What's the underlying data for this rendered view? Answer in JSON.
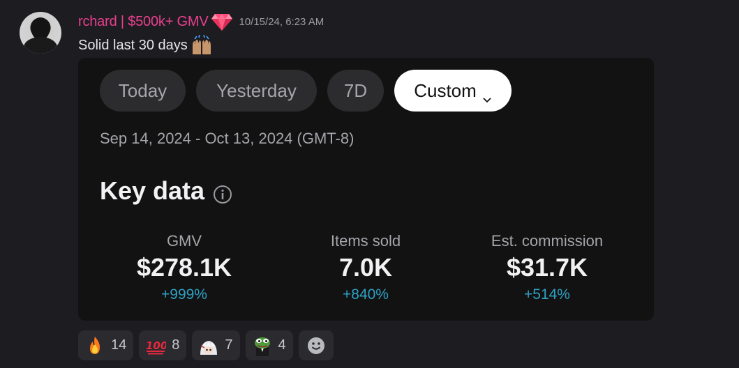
{
  "message": {
    "username": "rchard | $500k+ GMV",
    "badge_icon": "gem-icon",
    "timestamp": "10/15/24, 6:23 AM",
    "text": "Solid last 30 days",
    "text_emoji": "raised-hands-icon"
  },
  "embed": {
    "filters": [
      {
        "label": "Today",
        "active": false
      },
      {
        "label": "Yesterday",
        "active": false
      },
      {
        "label": "7D",
        "active": false
      },
      {
        "label": "Custom",
        "active": true,
        "icon": "chevron-down-icon"
      }
    ],
    "date_range": "Sep 14, 2024 - Oct 13, 2024 (GMT-8)",
    "section_title": "Key data",
    "section_icon": "info-icon",
    "metrics": [
      {
        "label": "GMV",
        "value": "$278.1K",
        "change": "+999%"
      },
      {
        "label": "Items sold",
        "value": "7.0K",
        "change": "+840%"
      },
      {
        "label": "Est. commission",
        "value": "$31.7K",
        "change": "+514%"
      }
    ],
    "colors": {
      "change": "#2fa1c4",
      "active_pill": "#ffffff",
      "pill": "#2c2c2e"
    }
  },
  "reactions": [
    {
      "icon": "fire-icon",
      "count": "14"
    },
    {
      "icon": "hundred-points-icon",
      "count": "8"
    },
    {
      "icon": "anime-character-icon",
      "count": "7"
    },
    {
      "icon": "pepe-frog-icon",
      "count": "4"
    }
  ],
  "add_reaction_icon": "add-reaction-smiley-icon",
  "colors": {
    "background": "#1d1d21",
    "username": "#ea3f8f"
  }
}
